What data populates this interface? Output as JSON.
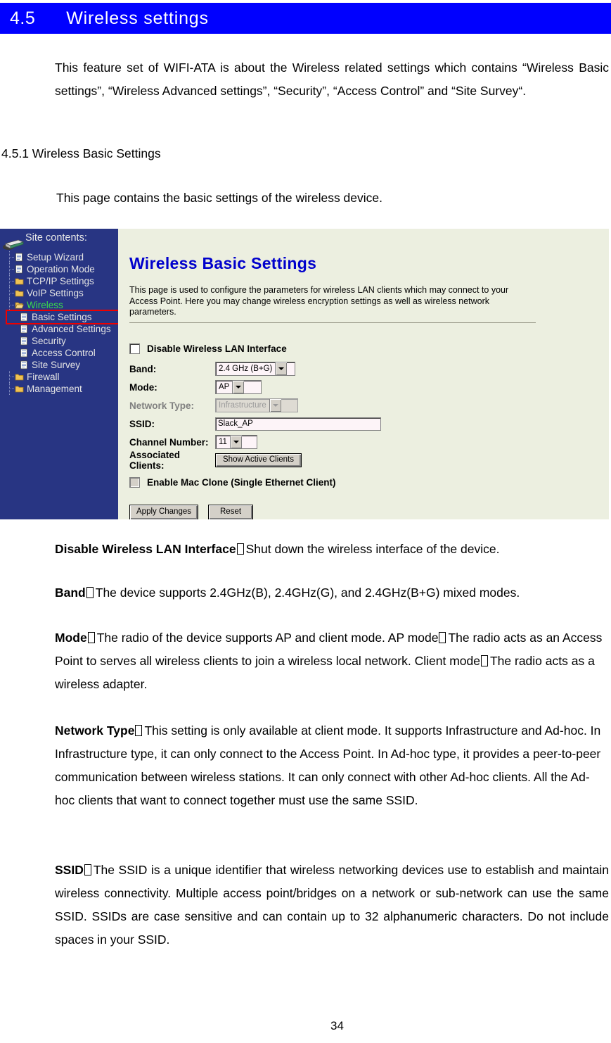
{
  "section": {
    "number": "4.5",
    "title": "Wireless settings",
    "banner_color": "#0000ff",
    "banner_text_color": "#ffffff"
  },
  "intro_paragraph": "This feature set of WIFI-ATA is about the Wireless related settings which contains “Wireless Basic settings”, “Wireless Advanced settings”, “Security”, “Access Control” and “Site Survey“.",
  "subsection": {
    "heading": "4.5.1 Wireless Basic Settings",
    "paragraph": "This page contains the basic settings of the wireless device."
  },
  "screenshot": {
    "sidebar": {
      "background_color": "#283583",
      "header": "Site contents:",
      "items": [
        {
          "label": "Setup Wizard",
          "icon": "page-icon",
          "level": 1,
          "state": "normal"
        },
        {
          "label": "Operation Mode",
          "icon": "page-icon",
          "level": 1,
          "state": "normal"
        },
        {
          "label": "TCP/IP Settings",
          "icon": "folder-icon",
          "level": 1,
          "state": "normal"
        },
        {
          "label": "VoIP Settings",
          "icon": "folder-icon",
          "level": 1,
          "state": "normal"
        },
        {
          "label": "Wireless",
          "icon": "open-folder-icon",
          "level": 1,
          "state": "expanded"
        },
        {
          "label": "Basic Settings",
          "icon": "page-icon",
          "level": 2,
          "state": "highlighted"
        },
        {
          "label": "Advanced Settings",
          "icon": "page-icon",
          "level": 2,
          "state": "normal"
        },
        {
          "label": "Security",
          "icon": "page-icon",
          "level": 2,
          "state": "normal"
        },
        {
          "label": "Access Control",
          "icon": "page-icon",
          "level": 2,
          "state": "normal"
        },
        {
          "label": "Site Survey",
          "icon": "page-icon",
          "level": 2,
          "state": "normal"
        },
        {
          "label": "Firewall",
          "icon": "folder-icon",
          "level": 1,
          "state": "normal"
        },
        {
          "label": "Management",
          "icon": "folder-icon",
          "level": 1,
          "state": "normal"
        }
      ],
      "highlight_color": "#ee0000",
      "expanded_label_color": "#3ddc4a"
    },
    "panel": {
      "background_color": "#ecefe0",
      "title": "Wireless Basic Settings",
      "title_color": "#0000cc",
      "description": "This page is used to configure the parameters for wireless LAN clients which may connect to your Access Point. Here you may change wireless encryption settings as well as wireless network parameters.",
      "disable_wlan": {
        "label": "Disable Wireless LAN Interface",
        "checked": false,
        "enabled": true
      },
      "fields": [
        {
          "label": "Band:",
          "value": "2.4 GHz (B+G)",
          "control": "select",
          "enabled": true
        },
        {
          "label": "Mode:",
          "value": "AP",
          "control": "select",
          "enabled": true
        },
        {
          "label": "Network Type:",
          "value": "Infrastructure",
          "control": "select",
          "enabled": false
        },
        {
          "label": "SSID:",
          "value": "Slack_AP",
          "control": "text",
          "enabled": true
        },
        {
          "label": "Channel Number:",
          "value": "11",
          "control": "select",
          "enabled": true
        },
        {
          "label": "Associated Clients:",
          "value": "Show Active Clients",
          "control": "button",
          "enabled": true
        }
      ],
      "mac_clone": {
        "label": "Enable Mac Clone (Single Ethernet Client)",
        "checked": false,
        "enabled": false
      },
      "buttons": {
        "apply": "Apply Changes",
        "reset": "Reset"
      }
    }
  },
  "descriptions": [
    {
      "term": "Disable Wireless LAN Interface",
      "text": "Shut down the wireless interface of the device."
    },
    {
      "term": "Band",
      "text": "The device supports 2.4GHz(B), 2.4GHz(G), and 2.4GHz(B+G) mixed modes."
    },
    {
      "term": "Mode",
      "text_part1": "The radio of the device supports AP and client mode. AP mode",
      "text_part2": "The radio acts as an Access Point to serves all wireless clients to join a wireless local network. Client mode",
      "text_part3": "The radio acts as a wireless adapter."
    },
    {
      "term": "Network Type",
      "text": "This setting is only available at client mode. It supports Infrastructure and Ad-hoc. In Infrastructure type, it can only connect to the Access Point. In Ad-hoc type, it provides a peer-to-peer communication between wireless stations. It can only connect with other Ad-hoc clients. All the Ad-hoc clients that want to connect together must use the same SSID."
    },
    {
      "term": "SSID",
      "text": "The SSID is a unique identifier that wireless networking devices use to establish and maintain wireless connectivity. Multiple access point/bridges on a network or sub-network can use the same SSID. SSIDs are case sensitive and can contain up to 32 alphanumeric characters. Do not include spaces in your SSID."
    }
  ],
  "page_number": "34"
}
